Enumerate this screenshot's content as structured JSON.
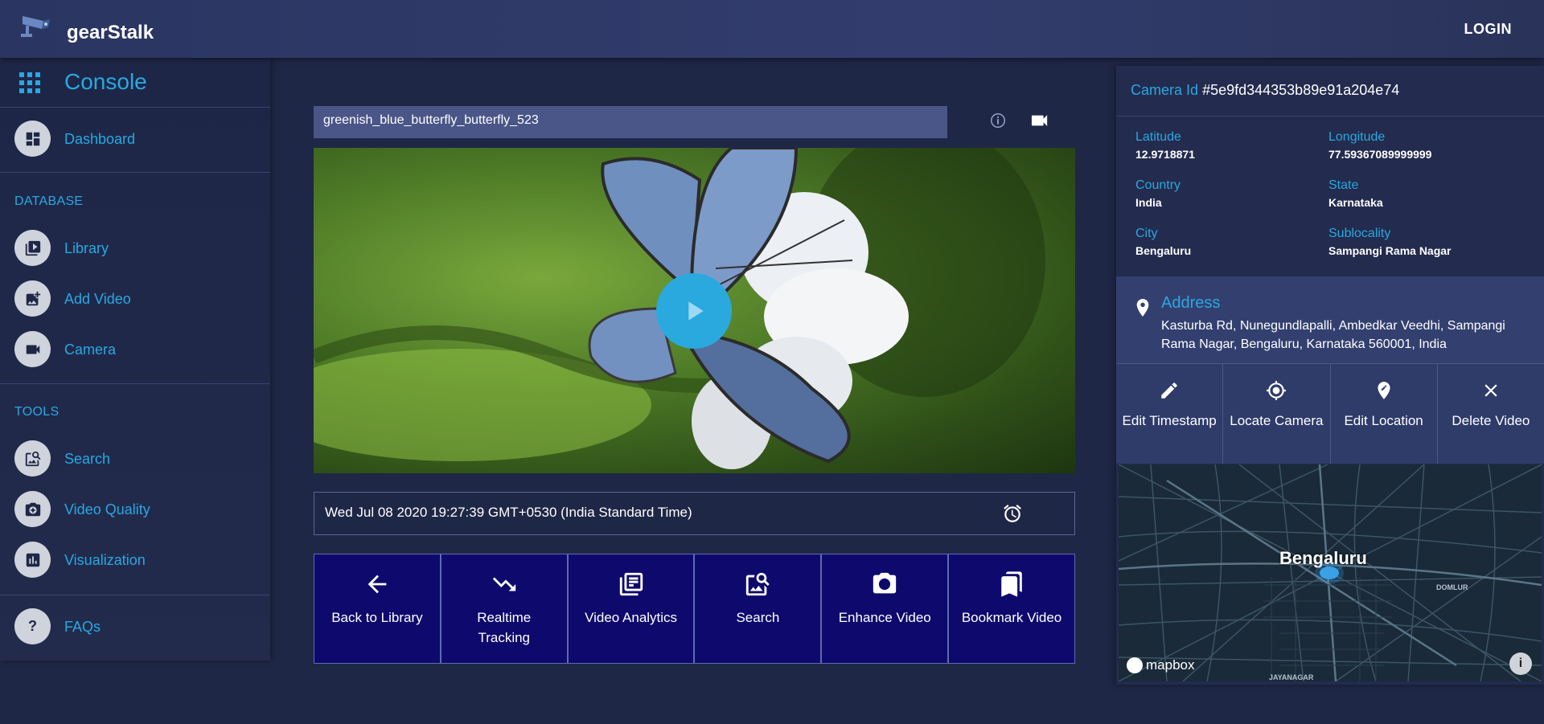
{
  "header": {
    "brand": "gearStalk",
    "login_label": "LOGIN"
  },
  "sidebar": {
    "console_label": "Console",
    "dashboard_label": "Dashboard",
    "database_heading": "DATABASE",
    "database_items": [
      {
        "label": "Library",
        "icon": "video-library-icon"
      },
      {
        "label": "Add Video",
        "icon": "add-photo-icon"
      },
      {
        "label": "Camera",
        "icon": "videocam-icon"
      }
    ],
    "tools_heading": "TOOLS",
    "tools_items": [
      {
        "label": "Search",
        "icon": "image-search-icon"
      },
      {
        "label": "Video Quality",
        "icon": "camera-enhance-icon"
      },
      {
        "label": "Visualization",
        "icon": "bar-chart-icon"
      }
    ],
    "faqs_label": "FAQs"
  },
  "video": {
    "title": "greenish_blue_butterfly_butterfly_523",
    "timestamp": "Wed Jul 08 2020 19:27:39 GMT+0530 (India Standard Time)"
  },
  "actions": [
    {
      "label": "Back to Library",
      "icon": "arrow-left-icon"
    },
    {
      "label": "Realtime Tracking",
      "icon": "trending-down-icon"
    },
    {
      "label": "Video Analytics",
      "icon": "library-icon"
    },
    {
      "label": "Search",
      "icon": "image-search-icon"
    },
    {
      "label": "Enhance Video",
      "icon": "camera-plus-icon"
    },
    {
      "label": "Bookmark Video",
      "icon": "bookmark-icon"
    }
  ],
  "camera": {
    "id_label": "Camera Id",
    "id_value": "#5e9fd344353b89e91a204e74",
    "latitude_label": "Latitude",
    "latitude": "12.9718871",
    "longitude_label": "Longitude",
    "longitude": "77.59367089999999",
    "country_label": "Country",
    "country": "India",
    "state_label": "State",
    "state": "Karnataka",
    "city_label": "City",
    "city": "Bengaluru",
    "sublocality_label": "Sublocality",
    "sublocality": "Sampangi Rama Nagar",
    "address_label": "Address",
    "address": "Kasturba Rd, Nunegundlapalli, Ambedkar Veedhi, Sampangi Rama Nagar, Bengaluru, Karnataka 560001, India"
  },
  "camera_actions": [
    {
      "label": "Edit Timestamp",
      "icon": "pencil-icon"
    },
    {
      "label": "Locate Camera",
      "icon": "gps-fixed-icon"
    },
    {
      "label": "Edit Location",
      "icon": "edit-location-icon"
    },
    {
      "label": "Delete Video",
      "icon": "close-icon"
    }
  ],
  "map": {
    "city_label": "Bengaluru",
    "small_label": "DOMLUR",
    "bottom_label": "JAYANAGAR",
    "attribution": "mapbox",
    "info_glyph": "i"
  },
  "colors": {
    "accent": "#29a8e0",
    "background": "#1f2746",
    "action_button": "#0e0a6d",
    "title_field": "#4a5688"
  }
}
